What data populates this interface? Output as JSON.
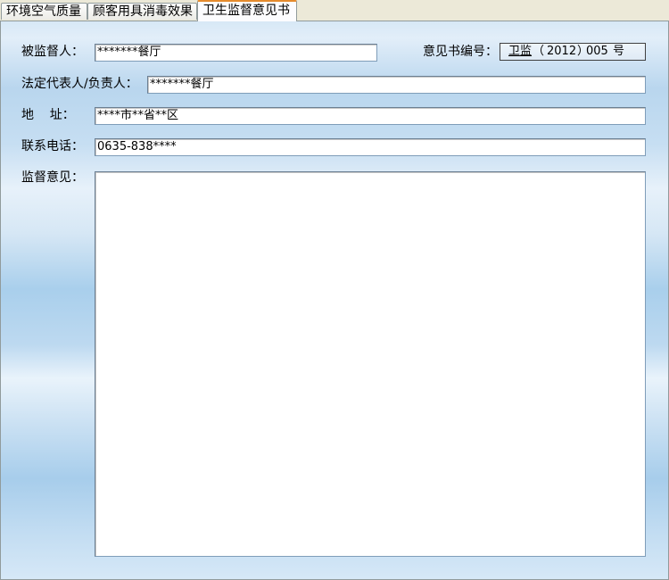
{
  "tabs": [
    {
      "label": "环境空气质量"
    },
    {
      "label": "顾客用具消毒效果"
    },
    {
      "label": "卫生监督意见书"
    }
  ],
  "form": {
    "supervisee_label": "被监督人：",
    "supervisee_value": "*******餐厅",
    "opinion_no_label": "意见书编号：",
    "opinion_no": {
      "prefix": "卫监",
      "open": "（",
      "year": "2012",
      "close": "）",
      "number": "005",
      "suffix": "号"
    },
    "legal_rep_label": "法定代表人/负责人：",
    "legal_rep_value": "*******餐厅",
    "address_label": "地    址：",
    "address_value": "****市**省**区",
    "phone_label": "联系电话：",
    "phone_value": "0635-838****",
    "opinion_label": "监督意见：",
    "opinion_value": ""
  }
}
